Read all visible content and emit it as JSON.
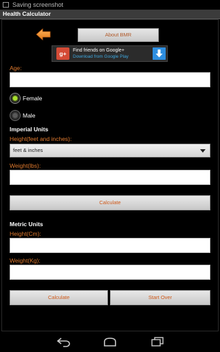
{
  "statusbar": {
    "text": "Saving screenshot"
  },
  "app": {
    "title": "Health Calculator"
  },
  "about_button": "About BMR",
  "ad": {
    "icon_text": "g+",
    "line1": "Find friends on Google+",
    "line2": "Download from Google Play"
  },
  "form": {
    "age_label": "Age:",
    "female_label": "Female",
    "male_label": "Male",
    "selected_gender": "Female",
    "imperial": {
      "title": "Imperial Units",
      "height_label": "Height(feet and inches):",
      "height_select_value": "feet & inches",
      "weight_label": "Weight(lbs):",
      "calculate_label": "Calculate"
    },
    "metric": {
      "title": "Metric Units",
      "height_label": "Height(Cm):",
      "weight_label": "Weight(Kg):",
      "calculate_label": "Calculate",
      "start_over_label": "Start Over"
    }
  },
  "colors": {
    "label_orange": "#e07a2e",
    "button_text": "#d05a1a",
    "radio_selected": "#a8e02e",
    "ad_link": "#3fa9e0",
    "gplus_red": "#d44b36"
  },
  "icons": {
    "back": "back-arrow-icon",
    "download": "download-icon",
    "nav_back": "nav-back-icon",
    "nav_home": "nav-home-icon",
    "nav_recents": "nav-recents-icon"
  }
}
